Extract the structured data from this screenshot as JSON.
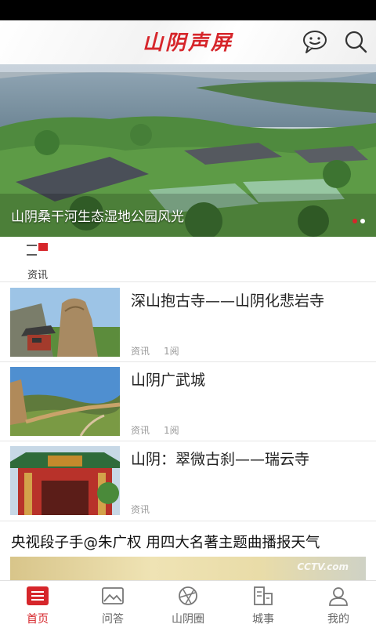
{
  "app": {
    "logo_text": "山阴声屏"
  },
  "colors": {
    "accent": "#d6262b",
    "muted": "#999999"
  },
  "header": {
    "icons": [
      "chat-bubble-icon",
      "search-icon"
    ]
  },
  "banner": {
    "caption": "山阴桑干河生态湿地公园风光",
    "slides": 2,
    "active_slide": 1
  },
  "category": {
    "label": "资讯",
    "icon": "category-menu-icon"
  },
  "articles": [
    {
      "title": "深山抱古寺——山阴化悲岩寺",
      "category": "资讯",
      "views": "1阅"
    },
    {
      "title": "山阴广武城",
      "category": "资讯",
      "views": "1阅"
    },
    {
      "title": "山阴：翠微古刹——瑞云寺",
      "category": "资讯",
      "views": ""
    }
  ],
  "feature": {
    "title": "央视段子手@朱广权 用四大名著主题曲播报天气",
    "watermark": "CCTV.com"
  },
  "tabs": [
    {
      "label": "首页",
      "icon": "home-list-icon",
      "active": true
    },
    {
      "label": "问答",
      "icon": "qa-image-icon",
      "active": false
    },
    {
      "label": "山阴圈",
      "icon": "circle-aperture-icon",
      "active": false
    },
    {
      "label": "城事",
      "icon": "city-news-icon",
      "active": false
    },
    {
      "label": "我的",
      "icon": "user-icon",
      "active": false
    }
  ]
}
